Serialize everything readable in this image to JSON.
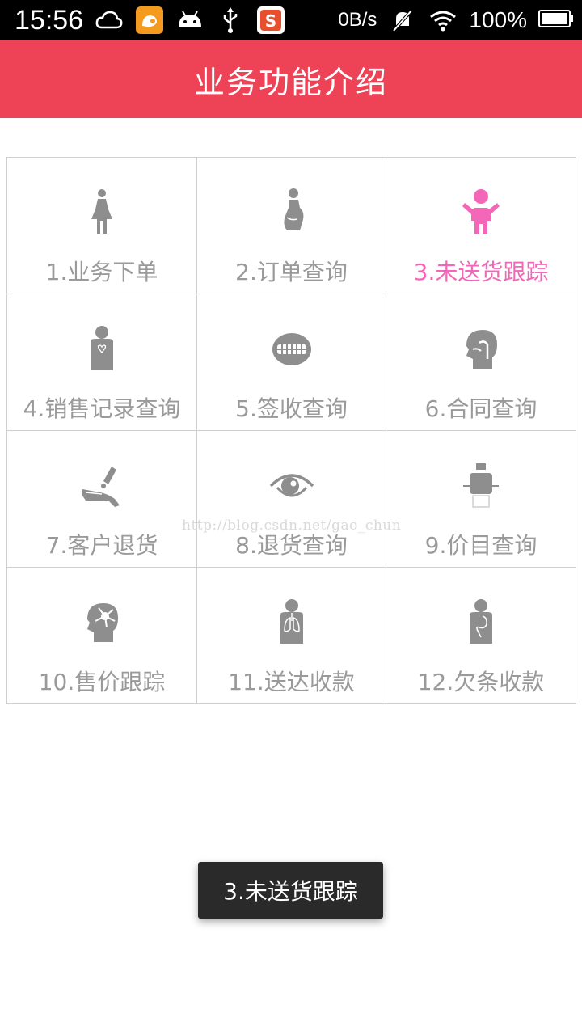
{
  "status_bar": {
    "time": "15:56",
    "left_icons": [
      "cloud-icon",
      "uc-browser-icon",
      "android-icon",
      "usb-icon",
      "sogou-input-icon"
    ],
    "net_speed": "0B/s",
    "battery": "100%"
  },
  "title_bar": {
    "title": "业务功能介绍",
    "color": "#ee4257"
  },
  "grid": {
    "items": [
      {
        "label": "1.业务下单",
        "icon": "woman-figure-icon"
      },
      {
        "label": "2.订单查询",
        "icon": "pregnant-figure-icon"
      },
      {
        "label": "3.未送货跟踪",
        "icon": "child-figure-icon",
        "active": true
      },
      {
        "label": "4.销售记录查询",
        "icon": "torso-heart-icon"
      },
      {
        "label": "5.签收查询",
        "icon": "mouth-teeth-icon"
      },
      {
        "label": "6.合同查询",
        "icon": "head-throat-icon"
      },
      {
        "label": "7.客户退货",
        "icon": "hand-cream-icon"
      },
      {
        "label": "8.退货查询",
        "icon": "eye-icon"
      },
      {
        "label": "9.价目查询",
        "icon": "body-scan-icon"
      },
      {
        "label": "10.售价跟踪",
        "icon": "head-neuron-icon"
      },
      {
        "label": "11.送达收款",
        "icon": "torso-lungs-icon"
      },
      {
        "label": "12.欠条收款",
        "icon": "torso-stomach-icon"
      }
    ],
    "icon_color": "#8e8e8e",
    "active_color": "#f467b8"
  },
  "watermark": "http://blog.csdn.net/gao_chun",
  "toast": {
    "text": "3.未送货跟踪"
  }
}
